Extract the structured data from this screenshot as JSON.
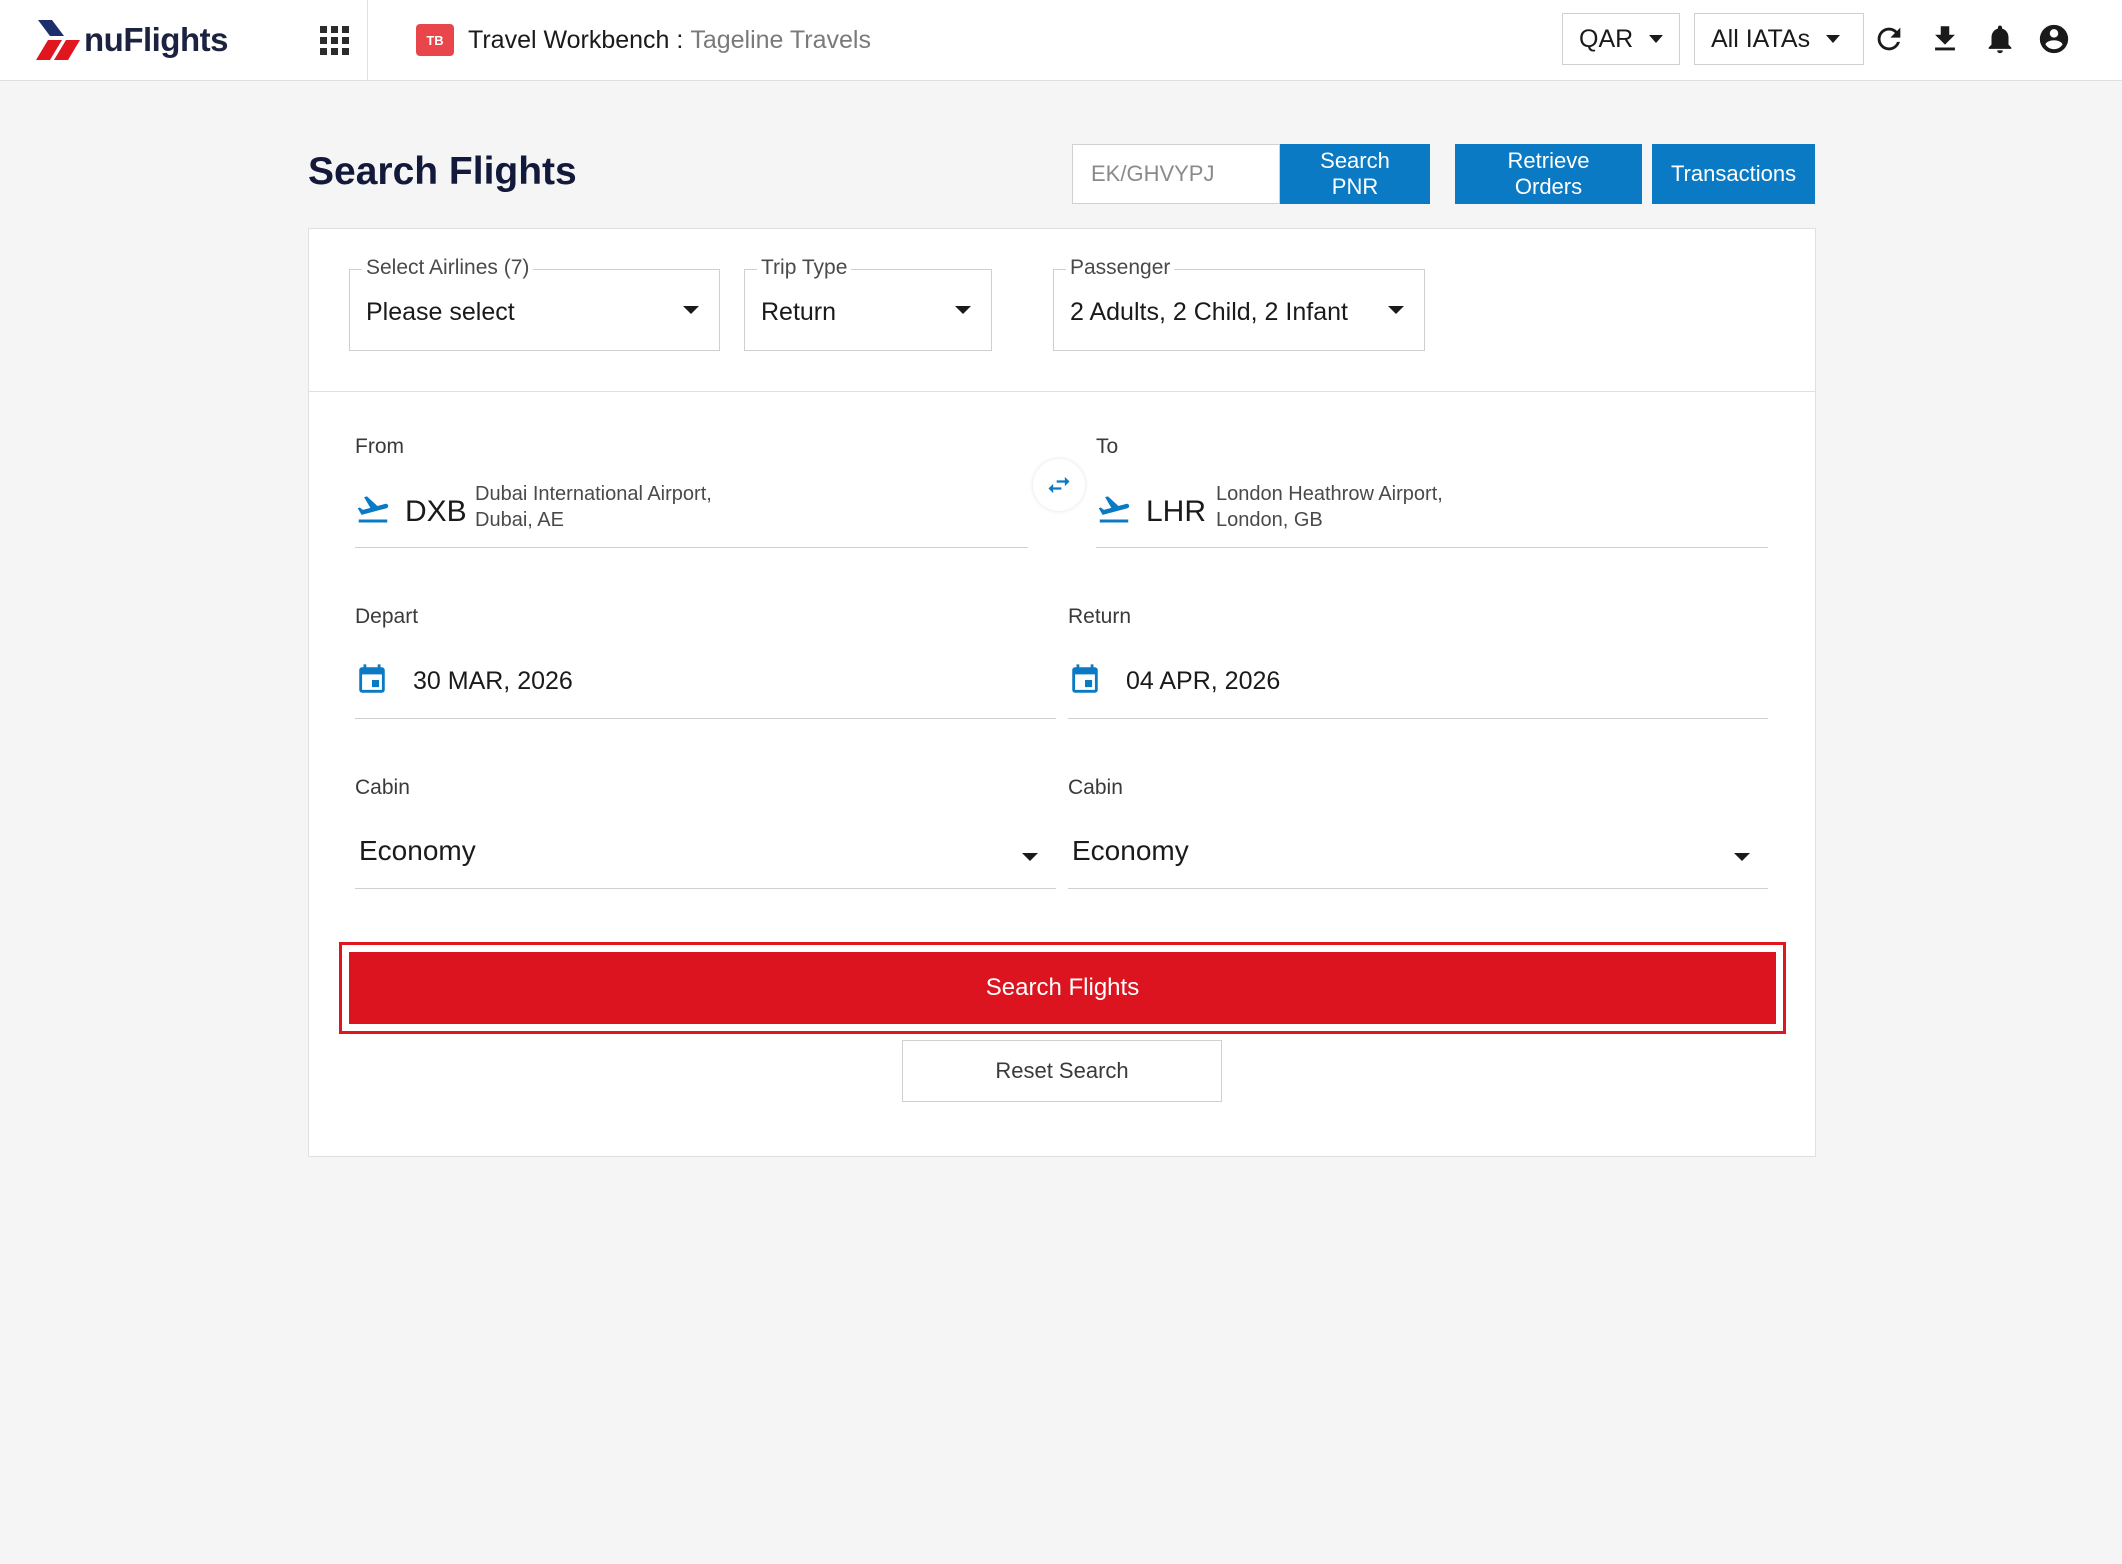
{
  "header": {
    "logo_text": "nuFlights",
    "app_icon_text": "TB",
    "workbench_title": "Travel Workbench",
    "separator": " : ",
    "agency_name": "Tageline Travels",
    "currency": "QAR",
    "iata_filter": "All IATAs",
    "icons": [
      "apps-grid-icon",
      "refresh-icon",
      "download-icon",
      "bell-icon",
      "account-icon"
    ]
  },
  "page": {
    "title": "Search Flights",
    "pnr_placeholder": "EK/GHVYPJ",
    "search_pnr_label": "Search PNR",
    "retrieve_orders_label": "Retrieve Orders",
    "transactions_label": "Transactions"
  },
  "filters": {
    "airlines": {
      "label": "Select Airlines (7)",
      "value": "Please select"
    },
    "trip_type": {
      "label": "Trip Type",
      "value": "Return"
    },
    "passenger": {
      "label": "Passenger",
      "value": "2 Adults, 2 Child, 2 Infant"
    }
  },
  "route": {
    "from": {
      "label": "From",
      "code": "DXB",
      "name_line1": "Dubai International Airport,",
      "name_line2": "Dubai, AE"
    },
    "to": {
      "label": "To",
      "code": "LHR",
      "name_line1": "London Heathrow Airport,",
      "name_line2": "London, GB"
    }
  },
  "dates": {
    "depart": {
      "label": "Depart",
      "value": "30 MAR, 2026"
    },
    "return": {
      "label": "Return",
      "value": "04 APR, 2026"
    }
  },
  "cabins": {
    "outbound": {
      "label": "Cabin",
      "value": "Economy"
    },
    "inbound": {
      "label": "Cabin",
      "value": "Economy"
    }
  },
  "actions": {
    "search_label": "Search Flights",
    "reset_label": "Reset Search"
  },
  "colors": {
    "brand_blue": "#0a7ac4",
    "brand_red": "#dc1420",
    "title_navy": "#13193a"
  }
}
